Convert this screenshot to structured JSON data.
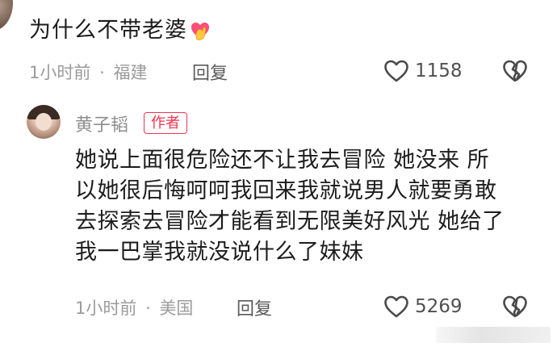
{
  "comment1": {
    "text": "为什么不带老婆",
    "emoji": "finger-heart-icon",
    "time": "1小时前",
    "separator": "·",
    "location": "福建",
    "reply_label": "回复",
    "likes": "1158"
  },
  "comment2": {
    "username": "黄子韬",
    "author_tag": "作者",
    "lines": [
      "她说上面很危险还不让我去冒险 她没来 所",
      "以她很后悔呵呵我回来我就说男人就要勇敢",
      "去探索去冒险才能看到无限美好风光 她给了",
      "我一巴掌我就没说什么了妹妹"
    ],
    "time": "1小时前",
    "separator": "·",
    "location": "美国",
    "reply_label": "回复",
    "likes": "5269"
  },
  "colors": {
    "author_tag": "#f4334f",
    "meta": "#9b9b9b",
    "text": "#1c1c1c"
  }
}
